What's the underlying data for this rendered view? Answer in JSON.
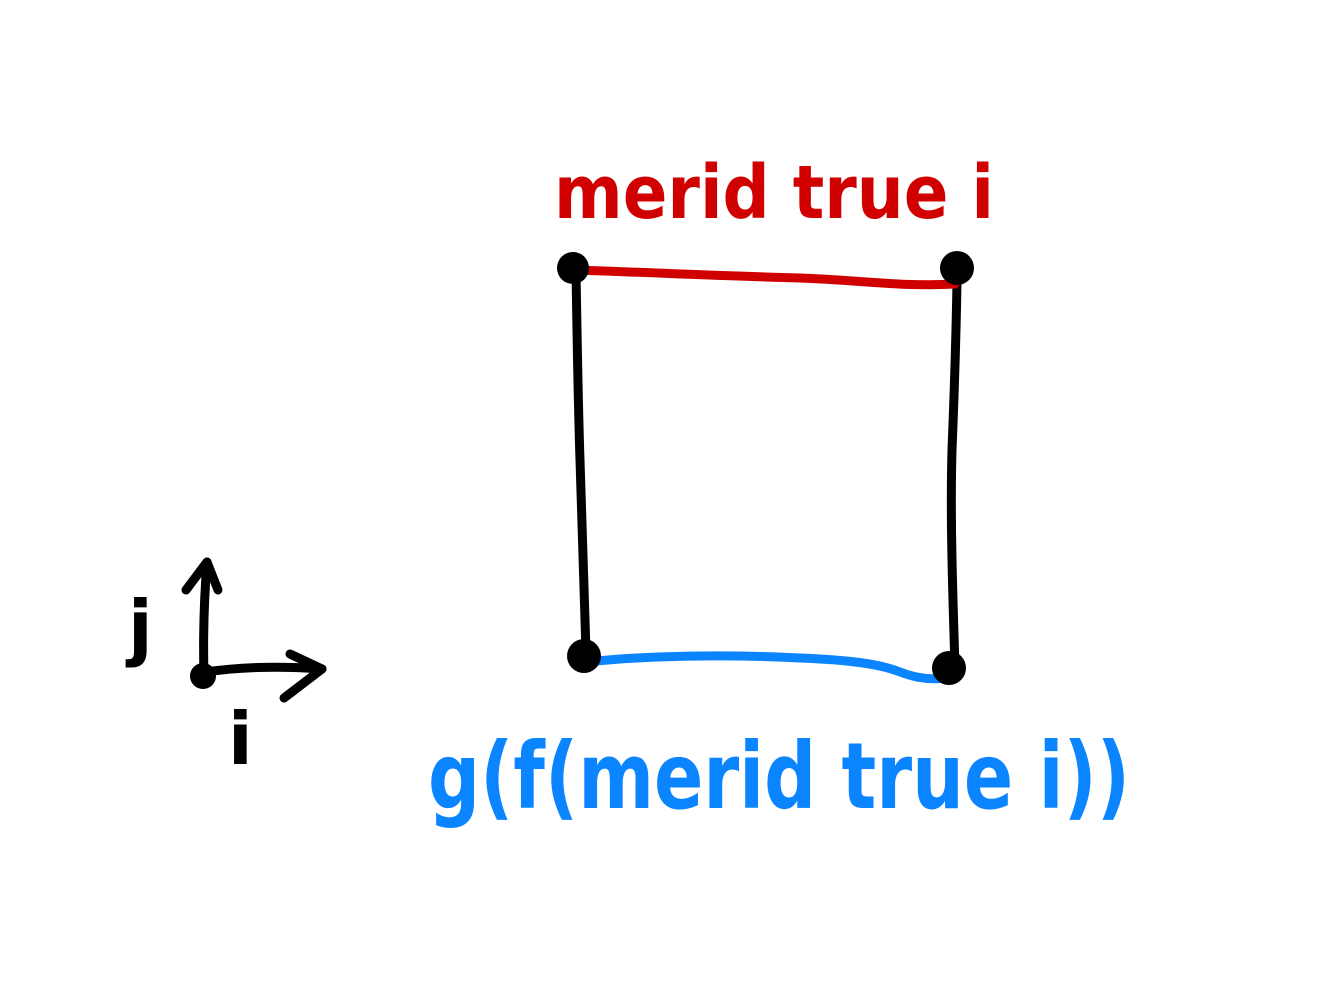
{
  "labels": {
    "top_edge": "merid true i",
    "bottom_edge": "g(f(merid true i))",
    "axis_j": "j",
    "axis_i": "i"
  },
  "colors": {
    "ink": "#000000",
    "top_edge": "#d10000",
    "bottom_edge": "#0a84ff",
    "background": "#ffffff"
  }
}
